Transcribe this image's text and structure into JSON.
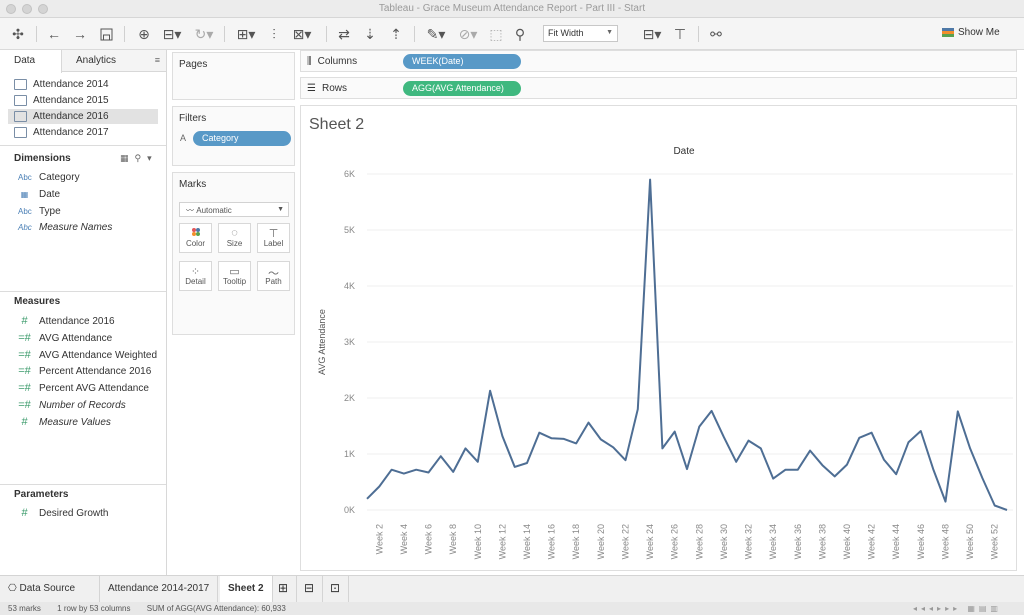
{
  "window": {
    "title": "Tableau - Grace Museum Attendance Report - Part III - Start"
  },
  "toolbar": {
    "fit_width": "Fit Width",
    "show_me": "Show Me"
  },
  "data_pane": {
    "tabs": [
      "Data",
      "Analytics"
    ],
    "datasources": [
      "Attendance 2014",
      "Attendance 2015",
      "Attendance 2016",
      "Attendance 2017"
    ],
    "selected_datasource": "Attendance 2016",
    "dimensions_title": "Dimensions",
    "dimensions": [
      {
        "icon": "Abc",
        "label": "Category"
      },
      {
        "icon": "date",
        "label": "Date"
      },
      {
        "icon": "Abc",
        "label": "Type"
      },
      {
        "icon": "Abc",
        "label": "Measure Names"
      }
    ],
    "measures_title": "Measures",
    "measures": [
      {
        "icon": "#",
        "label": "Attendance 2016"
      },
      {
        "icon": "=#",
        "label": "AVG Attendance"
      },
      {
        "icon": "=#",
        "label": "AVG Attendance Weighted"
      },
      {
        "icon": "#",
        "label": "Percent Attendance 2016"
      },
      {
        "icon": "#",
        "label": "Percent AVG Attendance"
      },
      {
        "icon": "=#",
        "label": "Number of Records"
      },
      {
        "icon": "#",
        "label": "Measure Values"
      }
    ],
    "parameters_title": "Parameters",
    "parameters": [
      {
        "icon": "#",
        "label": "Desired Growth"
      }
    ]
  },
  "pages": {
    "title": "Pages"
  },
  "filters": {
    "title": "Filters",
    "pills": [
      "Category"
    ]
  },
  "marks": {
    "title": "Marks",
    "type": "Automatic",
    "buttons": [
      "Color",
      "Size",
      "Label",
      "Detail",
      "Tooltip",
      "Path"
    ]
  },
  "shelves": {
    "columns_label": "Columns",
    "columns_pill": "WEEK(Date)",
    "rows_label": "Rows",
    "rows_pill": "AGG(AVG Attendance)"
  },
  "sheet": {
    "title": "Sheet 2",
    "column_header": "Date"
  },
  "chart_data": {
    "type": "line",
    "title": "Sheet 2",
    "xlabel": "Date",
    "ylabel": "AVG Attendance",
    "x_ticks": [
      "Week 2",
      "Week 4",
      "Week 6",
      "Week 8",
      "Week 10",
      "Week 12",
      "Week 14",
      "Week 16",
      "Week 18",
      "Week 20",
      "Week 22",
      "Week 24",
      "Week 26",
      "Week 28",
      "Week 30",
      "Week 32",
      "Week 34",
      "Week 36",
      "Week 38",
      "Week 40",
      "Week 42",
      "Week 44",
      "Week 46",
      "Week 48",
      "Week 50",
      "Week 52"
    ],
    "y_ticks": [
      "0K",
      "1K",
      "2K",
      "3K",
      "4K",
      "5K",
      "6K"
    ],
    "ylim": [
      0,
      6000
    ],
    "line_color": "#4e6e94",
    "series": [
      {
        "x": [
          1,
          2,
          3,
          4,
          5,
          6,
          7,
          8,
          9,
          10,
          11,
          12,
          13,
          14,
          15,
          16,
          17,
          18,
          19,
          20,
          21,
          22,
          23,
          24,
          25,
          26,
          27,
          28,
          29,
          30,
          31,
          32,
          33,
          34,
          35,
          36,
          37,
          38,
          39,
          40,
          41,
          42,
          43,
          44,
          45,
          46,
          47,
          48,
          49,
          50,
          51,
          52,
          53
        ],
        "values": [
          200,
          420,
          720,
          650,
          720,
          670,
          960,
          680,
          1100,
          860,
          2130,
          1320,
          770,
          840,
          1380,
          1280,
          1270,
          1190,
          1560,
          1260,
          1120,
          890,
          1800,
          5900,
          1100,
          1400,
          730,
          1490,
          1770,
          1300,
          860,
          1240,
          1100,
          560,
          720,
          720,
          1060,
          800,
          600,
          810,
          1290,
          1380,
          900,
          640,
          1210,
          1410,
          730,
          150,
          1760,
          1100,
          570,
          80,
          0
        ]
      }
    ],
    "grid": true
  },
  "sheet_tabs": {
    "data_source": "Data Source",
    "tabs": [
      "Attendance 2014-2017",
      "Sheet 2"
    ],
    "active": "Sheet 2"
  },
  "status": {
    "marks": "53 marks",
    "rows_cols": "1 row by 53 columns",
    "sum": "SUM of AGG(AVG Attendance): 60,933"
  }
}
